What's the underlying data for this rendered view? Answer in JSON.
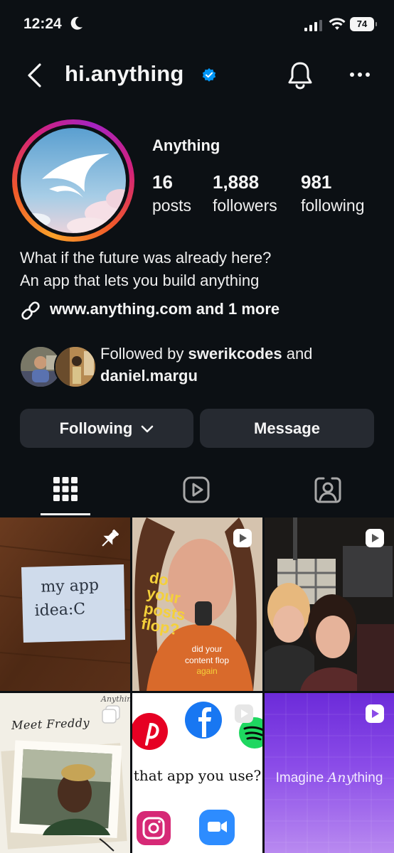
{
  "status_bar": {
    "time": "12:24",
    "battery": "74"
  },
  "header": {
    "username": "hi.anything"
  },
  "profile": {
    "display_name": "Anything",
    "stats": [
      {
        "value": "16",
        "label": "posts"
      },
      {
        "value": "1,888",
        "label": "followers"
      },
      {
        "value": "981",
        "label": "following"
      }
    ],
    "bio_lines": [
      "What if the future was already here?",
      "An app that lets you build anything"
    ],
    "link": "www.anything.com and 1 more",
    "followed_by": {
      "prefix": "Followed by ",
      "user1": "swerikcodes",
      "middle": " and",
      "user2": "daniel.margu"
    }
  },
  "actions": {
    "following_label": "Following",
    "message_label": "Message"
  },
  "tabs": [
    "grid-icon",
    "reels-icon",
    "tagged-icon"
  ],
  "posts": [
    {
      "kind": "photo",
      "text": "my app idea:C",
      "badge": "pin-icon"
    },
    {
      "kind": "reel",
      "lines": [
        "do",
        "your",
        "posts",
        "flop?"
      ],
      "caption1": "did your",
      "caption2": "content flop",
      "caption3": "again",
      "badge": "reel-icon"
    },
    {
      "kind": "reel",
      "badge": "reel-icon"
    },
    {
      "kind": "carousel",
      "title": "Meet Freddy",
      "brand": "Anything",
      "badge": "carousel-icon"
    },
    {
      "kind": "reel",
      "text": "that app you use?",
      "badge": "reel-icon"
    },
    {
      "kind": "reel",
      "text_plain": "Imagine ",
      "text_italic": "Any",
      "text_end": "thing",
      "badge": "reel-icon"
    }
  ],
  "colors": {
    "background": "#0c1014",
    "button": "#262a31",
    "verified": "#0095f6"
  }
}
